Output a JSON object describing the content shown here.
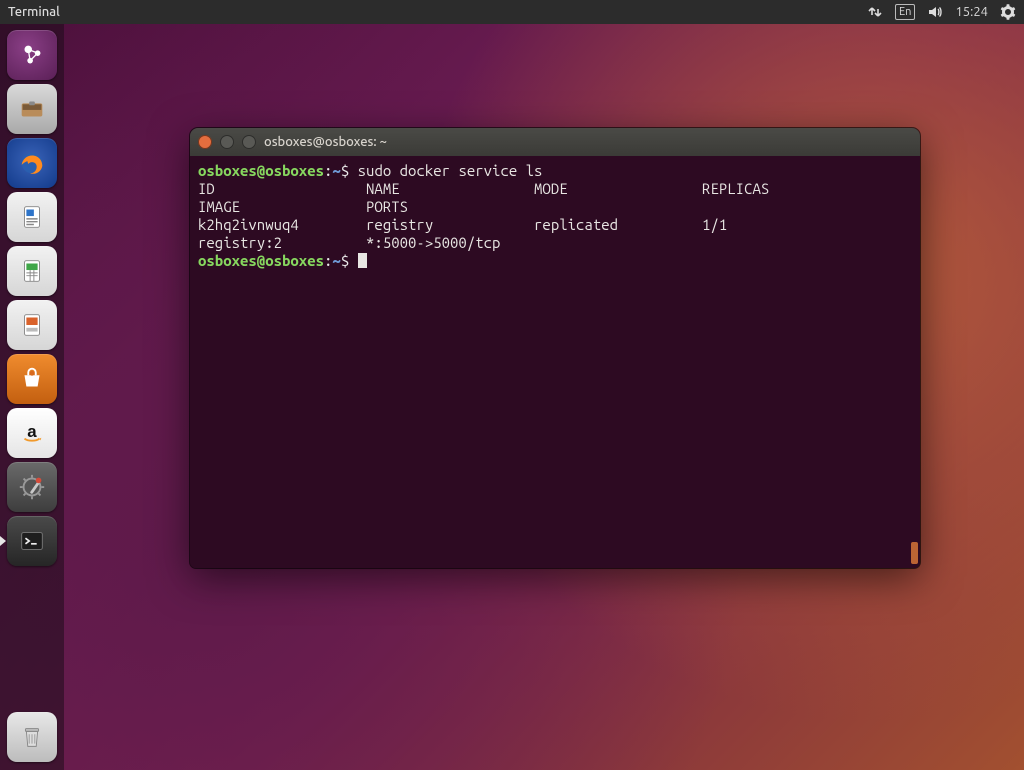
{
  "menubar": {
    "app_title": "Terminal",
    "language": "En",
    "clock": "15:24"
  },
  "launcher": {
    "items": [
      {
        "name": "dash",
        "title": "Dash"
      },
      {
        "name": "files",
        "title": "Files"
      },
      {
        "name": "firefox",
        "title": "Firefox"
      },
      {
        "name": "writer",
        "title": "LibreOffice Writer"
      },
      {
        "name": "calc",
        "title": "LibreOffice Calc"
      },
      {
        "name": "impress",
        "title": "LibreOffice Impress"
      },
      {
        "name": "software",
        "title": "Ubuntu Software"
      },
      {
        "name": "amazon",
        "title": "Amazon"
      },
      {
        "name": "settings",
        "title": "System Settings"
      },
      {
        "name": "terminal",
        "title": "Terminal"
      }
    ],
    "trash": "Trash"
  },
  "terminal": {
    "title": "osboxes@osboxes: ~",
    "prompt": {
      "userhost": "osboxes@osboxes",
      "colon": ":",
      "path": "~",
      "sigil": "$"
    },
    "command": "sudo docker service ls",
    "headers": {
      "id": "ID",
      "name": "NAME",
      "mode": "MODE",
      "replicas": "REPLICAS",
      "image": "IMAGE",
      "ports": "PORTS"
    },
    "rows": [
      {
        "id": "k2hq2ivnwuq4",
        "name": "registry",
        "mode": "replicated",
        "replicas": "1/1",
        "image": "registry:2",
        "ports": "*:5000->5000/tcp"
      }
    ]
  }
}
